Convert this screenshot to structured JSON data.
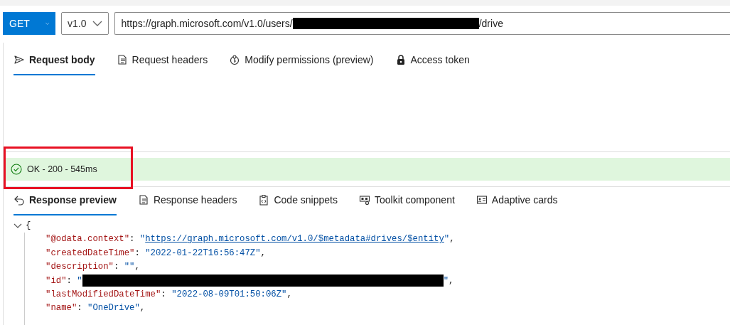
{
  "request_bar": {
    "method": "GET",
    "version": "v1.0",
    "url": {
      "prefix": "https://graph.microsoft.com/v1.0/users/",
      "redacted": true,
      "suffix": "/drive"
    }
  },
  "request_tabs": [
    {
      "label": "Request body",
      "selected": true
    },
    {
      "label": "Request headers",
      "selected": false
    },
    {
      "label": "Modify permissions (preview)",
      "selected": false
    },
    {
      "label": "Access token",
      "selected": false
    }
  ],
  "status": {
    "text": "OK - 200 - 545ms",
    "kind": "success",
    "highlighted": true
  },
  "response_tabs": [
    {
      "label": "Response preview",
      "selected": true
    },
    {
      "label": "Response headers",
      "selected": false
    },
    {
      "label": "Code snippets",
      "selected": false
    },
    {
      "label": "Toolkit component",
      "selected": false
    },
    {
      "label": "Adaptive cards",
      "selected": false
    }
  ],
  "response": {
    "open": "{",
    "expanded": true,
    "lines": [
      {
        "segments": [
          {
            "kind": "key",
            "text": "\"@odata.context\""
          },
          {
            "kind": "punct",
            "text": ": "
          },
          {
            "kind": "string",
            "text": "\""
          },
          {
            "kind": "link",
            "text": "https://graph.microsoft.com/v1.0/$metadata#drives/$entity"
          },
          {
            "kind": "string",
            "text": "\""
          },
          {
            "kind": "punct",
            "text": ","
          }
        ]
      },
      {
        "segments": [
          {
            "kind": "key",
            "text": "\"createdDateTime\""
          },
          {
            "kind": "punct",
            "text": ": "
          },
          {
            "kind": "string",
            "text": "\"2022-01-22T16:56:47Z\""
          },
          {
            "kind": "punct",
            "text": ","
          }
        ]
      },
      {
        "segments": [
          {
            "kind": "key",
            "text": "\"description\""
          },
          {
            "kind": "punct",
            "text": ": "
          },
          {
            "kind": "string",
            "text": "\"\""
          },
          {
            "kind": "punct",
            "text": ","
          }
        ]
      },
      {
        "segments": [
          {
            "kind": "key",
            "text": "\"id\""
          },
          {
            "kind": "punct",
            "text": ": "
          },
          {
            "kind": "string",
            "text": "\""
          },
          {
            "kind": "redacted"
          },
          {
            "kind": "string",
            "text": "\""
          },
          {
            "kind": "punct",
            "text": ","
          }
        ]
      },
      {
        "segments": [
          {
            "kind": "key",
            "text": "\"lastModifiedDateTime\""
          },
          {
            "kind": "punct",
            "text": ": "
          },
          {
            "kind": "string",
            "text": "\"2022-08-09T01:50:06Z\""
          },
          {
            "kind": "punct",
            "text": ","
          }
        ]
      },
      {
        "segments": [
          {
            "kind": "key",
            "text": "\"name\""
          },
          {
            "kind": "punct",
            "text": ": "
          },
          {
            "kind": "string",
            "text": "\"OneDrive\""
          },
          {
            "kind": "punct",
            "text": ","
          }
        ]
      }
    ]
  }
}
